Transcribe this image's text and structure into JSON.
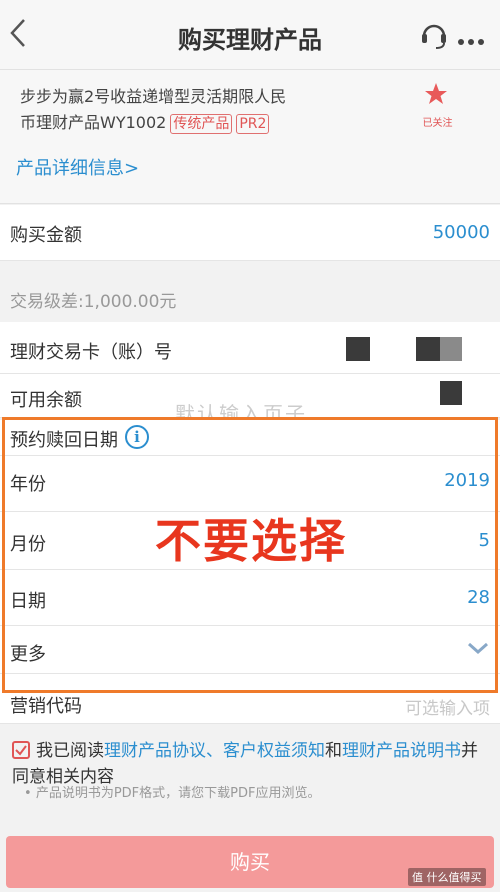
{
  "nav": {
    "title": "购买理财产品"
  },
  "product": {
    "name_line1": "步步为赢2号收益递增型灵活期限人民",
    "name_line2": "币理财产品WY1002",
    "tag_type": "传统产品",
    "tag_risk": "PR2",
    "followed": "已关注",
    "detail_link": "产品详细信息>"
  },
  "amount": {
    "label": "购买金额",
    "value": "50000"
  },
  "diff": "交易级差:1,000.00元",
  "card": {
    "label": "理财交易卡（账）号"
  },
  "balance": {
    "label": "可用余额"
  },
  "faded_text": "默认输入页子",
  "redeem": {
    "title": "预约赎回日期",
    "year_label": "年份",
    "year_value": "2019",
    "month_label": "月份",
    "month_value": "5",
    "day_label": "日期",
    "day_value": "28",
    "more_label": "更多"
  },
  "annotation": "不要选择",
  "marketing": {
    "label": "营销代码",
    "placeholder": "可选输入项"
  },
  "agreement": {
    "pre": "我已阅读",
    "link1": "理财产品协议、客户权益须知",
    "mid": "和",
    "link2": "理财产品说明书",
    "post": "并同意相关内容"
  },
  "note": "产品说明书为PDF格式，请您下载PDF应用浏览。",
  "buy_button": "购买",
  "watermark": "值 什么值得买",
  "colors": {
    "accent": "#2b8ecf",
    "highlight": "#ef7a2a",
    "danger": "#e8361e",
    "button": "#f49a9a"
  }
}
